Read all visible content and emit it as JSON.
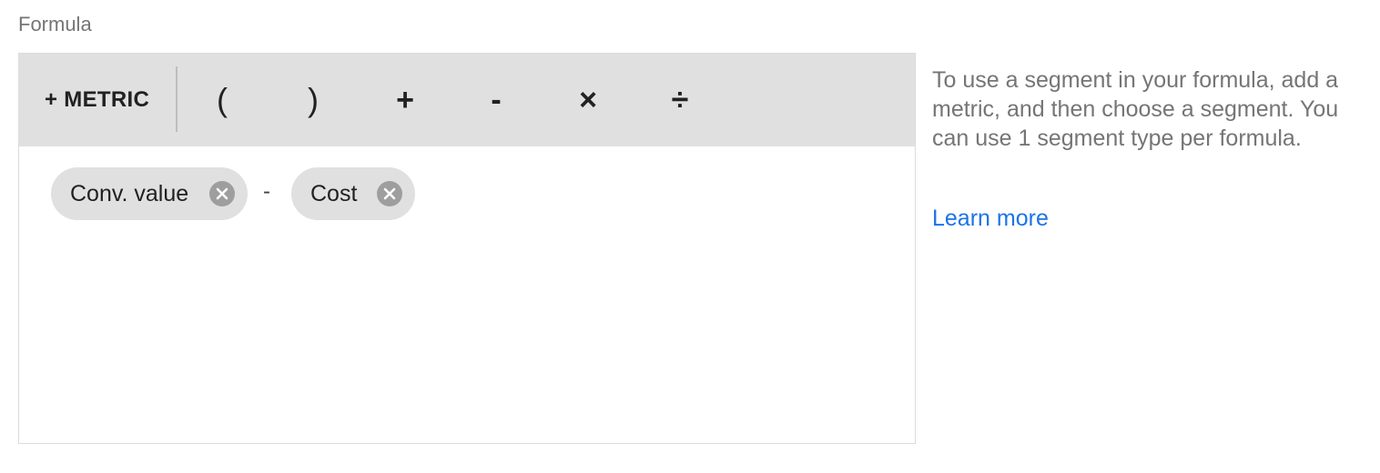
{
  "formula": {
    "label": "Formula",
    "toolbar": {
      "metric_button": "+ METRIC",
      "operators": {
        "paren_open": "(",
        "paren_close": ")",
        "plus": "+",
        "minus": "-",
        "times": "×",
        "divide": "÷"
      }
    },
    "expression": {
      "chips": [
        {
          "label": "Conv. value",
          "remove_icon": "close-circle-icon"
        },
        {
          "label": "Cost",
          "remove_icon": "close-circle-icon"
        }
      ],
      "operator": "-"
    }
  },
  "help": {
    "text": "To use a segment in your formula, add a metric, and then choose a segment. You can use 1 segment type per formula.",
    "learn_more": "Learn more"
  },
  "colors": {
    "toolbar_bg": "#e0e0e0",
    "chip_bg": "#e0e0e0",
    "link": "#1a73e8",
    "muted_text": "#757575"
  }
}
